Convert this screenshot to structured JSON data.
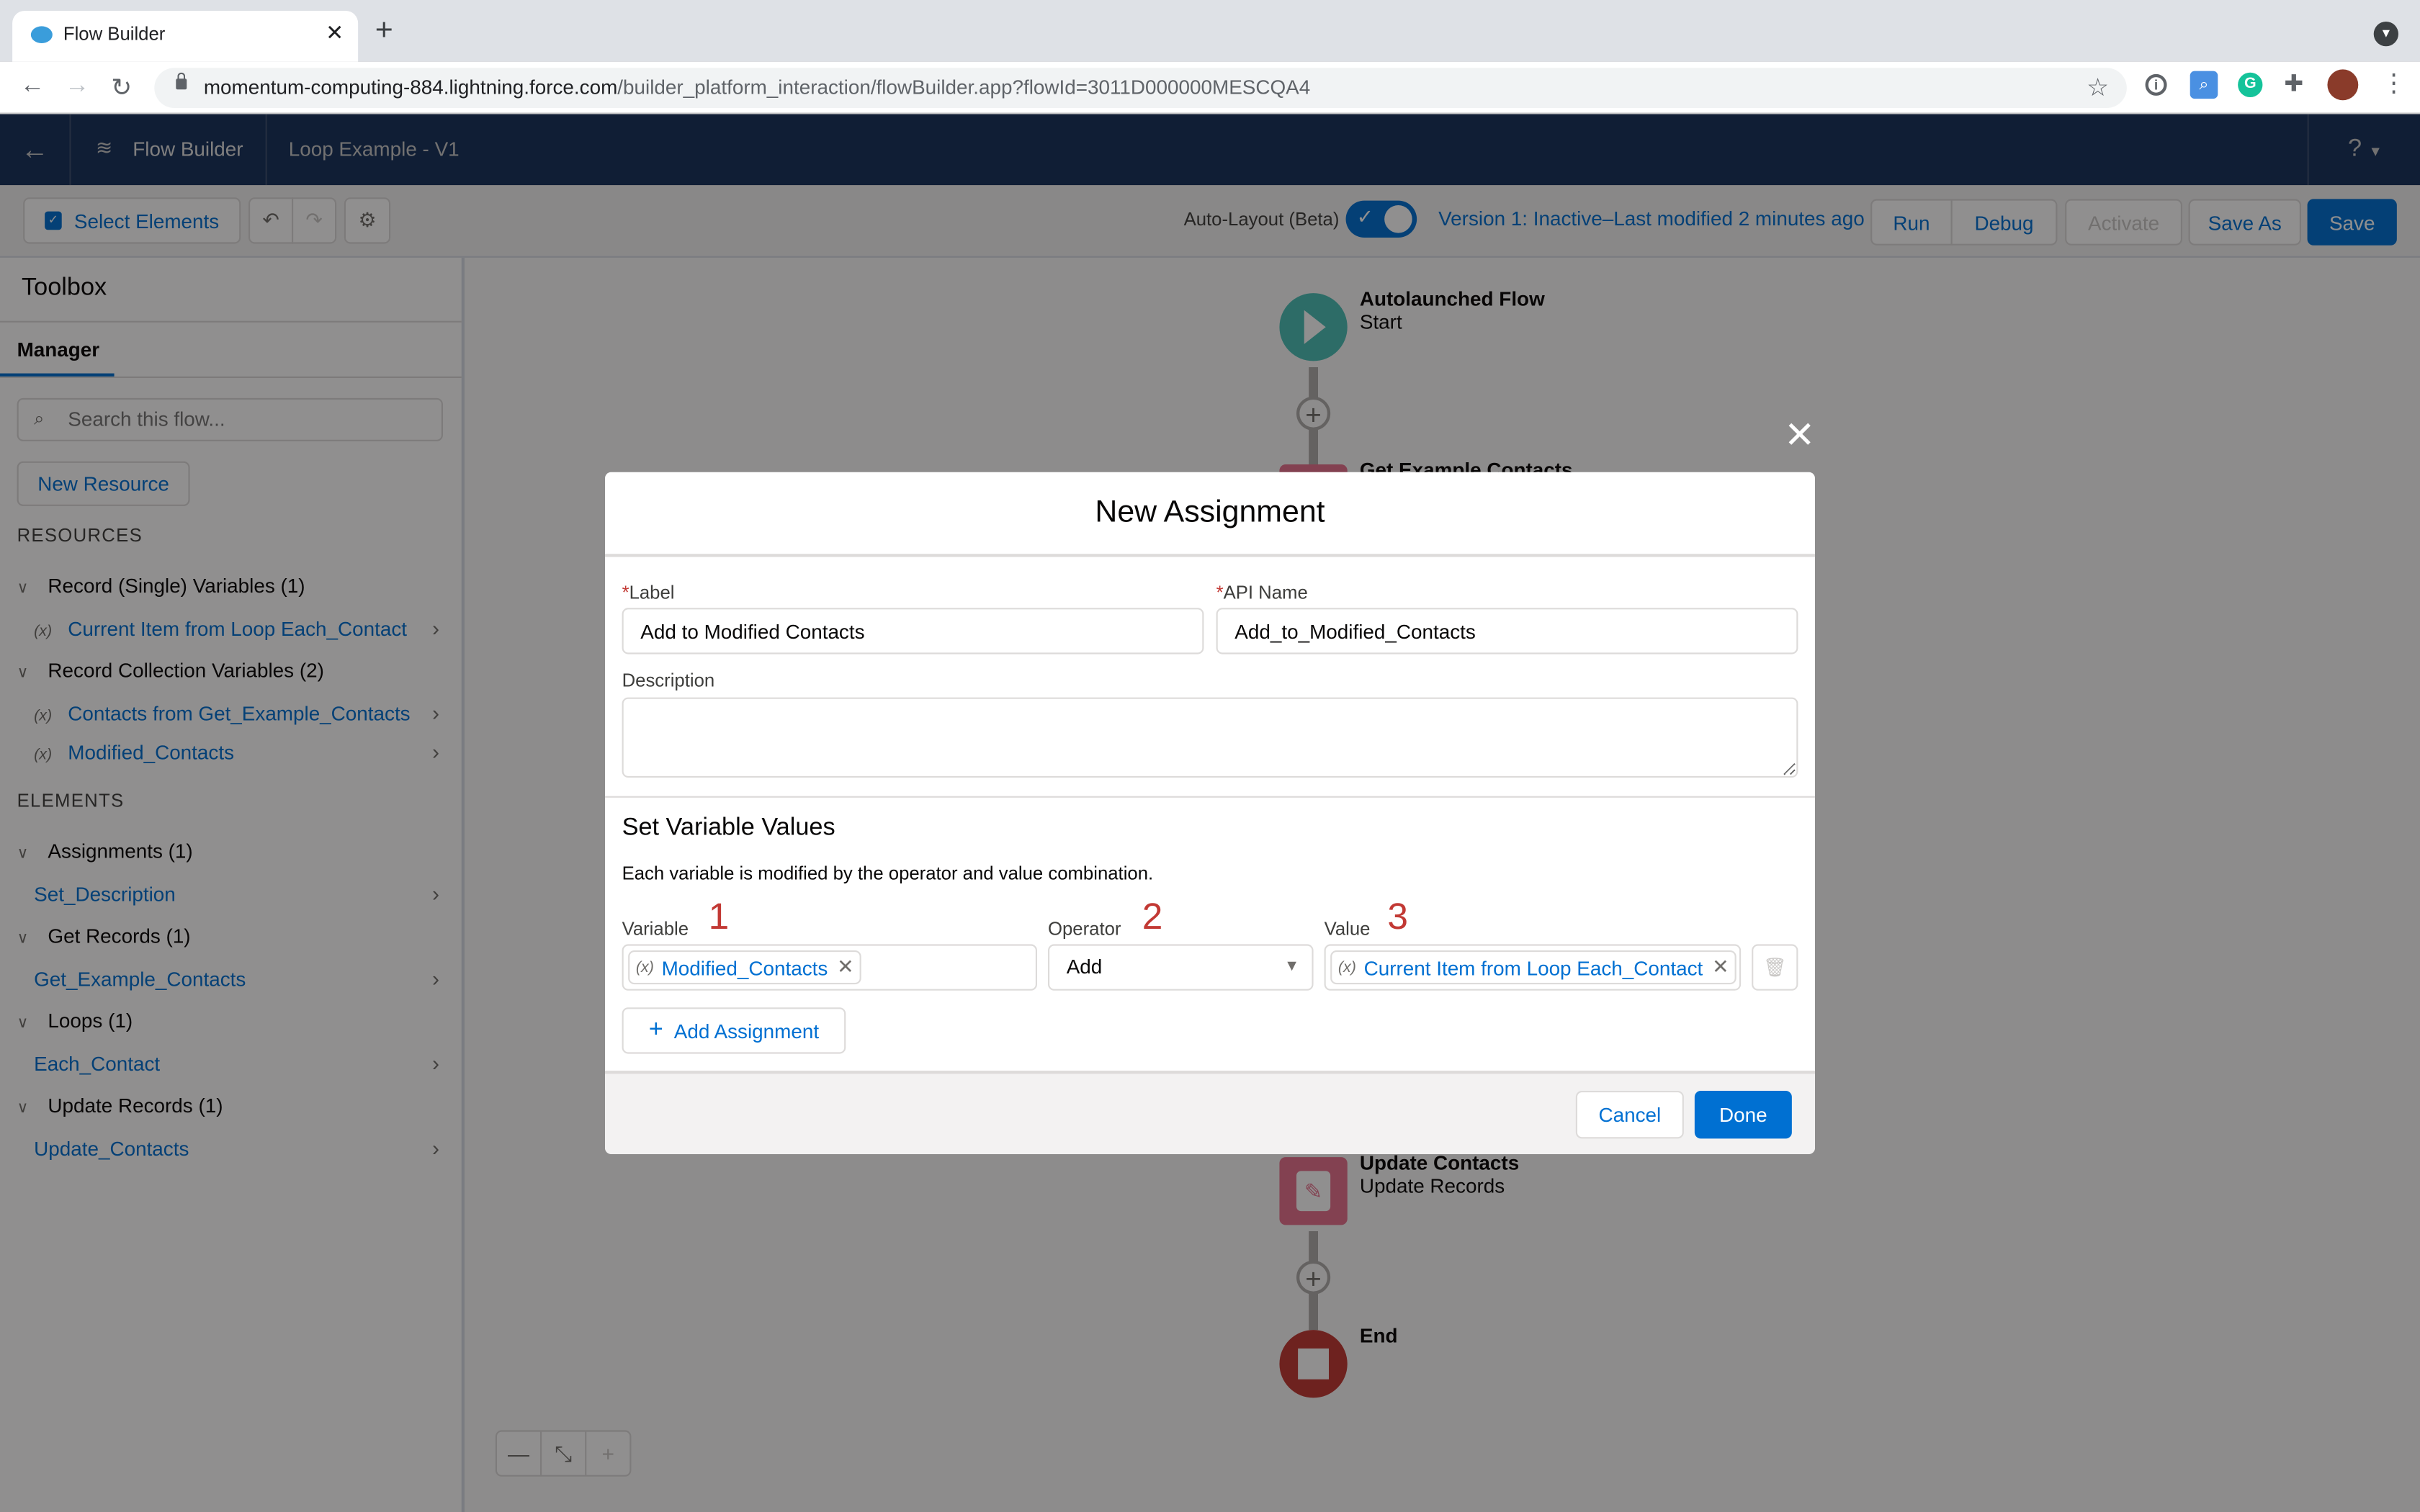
{
  "browser": {
    "tab_title": "Flow Builder",
    "url_host": "momentum-computing-884.lightning.force.com",
    "url_path": "/builder_platform_interaction/flowBuilder.app?flowId=3011D000000MESCQA4",
    "icons": [
      "back-icon",
      "forward-icon",
      "reload-icon",
      "lock-icon",
      "star-icon",
      "password-manager-icon",
      "search-extension-icon",
      "grammarly-icon",
      "extensions-icon",
      "profile-avatar",
      "menu-icon"
    ]
  },
  "header": {
    "app_name": "Flow Builder",
    "flow_name": "Loop Example - V1",
    "help": "?"
  },
  "toolbar": {
    "select_elements": "Select Elements",
    "auto_layout_label": "Auto-Layout (Beta)",
    "auto_layout_on": true,
    "version_info": "Version 1: Inactive–Last modified 2 minutes ago",
    "run": "Run",
    "debug": "Debug",
    "activate": "Activate",
    "save_as": "Save As",
    "save": "Save"
  },
  "sidebar": {
    "title": "Toolbox",
    "tab": "Manager",
    "search_placeholder": "Search this flow...",
    "new_resource": "New Resource",
    "resources_heading": "RESOURCES",
    "elements_heading": "ELEMENTS",
    "resource_groups": [
      {
        "label": "Record (Single) Variables (1)",
        "items": [
          "Current Item from Loop Each_Contact"
        ]
      },
      {
        "label": "Record Collection Variables (2)",
        "items": [
          "Contacts from Get_Example_Contacts",
          "Modified_Contacts"
        ]
      }
    ],
    "element_groups": [
      {
        "label": "Assignments (1)",
        "items": [
          "Set_Description"
        ]
      },
      {
        "label": "Get Records (1)",
        "items": [
          "Get_Example_Contacts"
        ]
      },
      {
        "label": "Loops (1)",
        "items": [
          "Each_Contact"
        ]
      },
      {
        "label": "Update Records (1)",
        "items": [
          "Update_Contacts"
        ]
      }
    ]
  },
  "canvas": {
    "nodes": [
      {
        "title": "Autolaunched Flow",
        "subtitle": "Start",
        "type": "start",
        "color": "#4bc0b6"
      },
      {
        "title": "Get Example Contacts",
        "subtitle": "",
        "type": "get-records",
        "color": "#e8728e"
      },
      {
        "title": "Update Contacts",
        "subtitle": "Update Records",
        "type": "update-records",
        "color": "#e8728e"
      },
      {
        "title": "End",
        "subtitle": "",
        "type": "end",
        "color": "#c23934"
      }
    ],
    "zoom_controls": [
      "zoom-out",
      "fit-to-view",
      "zoom-in"
    ]
  },
  "modal": {
    "title": "New Assignment",
    "label_field": {
      "label": "Label",
      "value": "Add to Modified Contacts",
      "required": true
    },
    "api_name_field": {
      "label": "API Name",
      "value": "Add_to_Modified_Contacts",
      "required": true
    },
    "description_field": {
      "label": "Description",
      "value": ""
    },
    "section_title": "Set Variable Values",
    "section_desc": "Each variable is modified by the operator and value combination.",
    "variable_label": "Variable",
    "operator_label": "Operator",
    "value_label": "Value",
    "annotations": [
      "1",
      "2",
      "3"
    ],
    "variable_value": "Modified_Contacts",
    "operator_value": "Add",
    "value_value": "Current Item from Loop Each_Contact",
    "add_assignment": "Add Assignment",
    "cancel": "Cancel",
    "done": "Done"
  }
}
